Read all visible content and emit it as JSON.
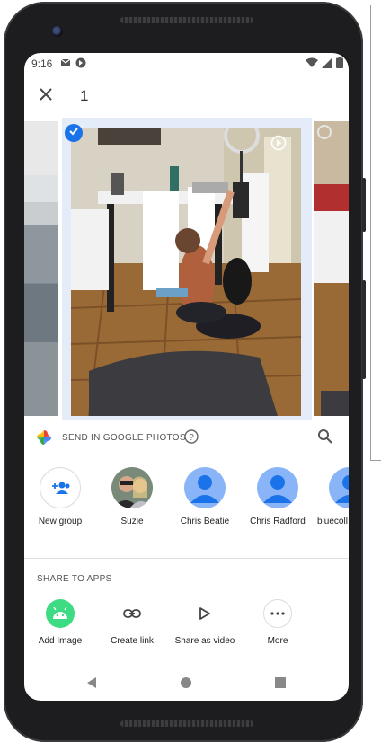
{
  "status_bar": {
    "time": "9:16",
    "left_icons": [
      "gmail-icon",
      "app-notification-icon"
    ],
    "right_icons": [
      "wifi-icon",
      "signal-icon",
      "battery-icon"
    ]
  },
  "top_bar": {
    "close_icon": "close-icon",
    "selected_count": "1"
  },
  "carousel": {
    "selected": true,
    "main_photo_is_video": true
  },
  "send_section": {
    "title": "SEND IN GOOGLE PHOTOS",
    "help_icon": "help-icon",
    "search_icon": "search-icon"
  },
  "contacts": [
    {
      "label": "New group",
      "icon": "add-group-icon"
    },
    {
      "label": "Suzie",
      "icon": "avatar-photo"
    },
    {
      "label": "Chris Beatie",
      "icon": "person-icon"
    },
    {
      "label": "Chris Radford",
      "icon": "person-icon"
    },
    {
      "label": "bluecoll",
      "icon": "person-icon"
    }
  ],
  "share_section": {
    "title": "SHARE TO APPS",
    "apps": [
      {
        "label": "Add Image",
        "icon": "android-icon"
      },
      {
        "label": "Create link",
        "icon": "link-icon"
      },
      {
        "label": "Share as video",
        "icon": "play-icon"
      },
      {
        "label": "More",
        "icon": "more-icon"
      }
    ]
  },
  "nav_bar": {
    "items": [
      "back-icon",
      "home-icon",
      "recents-icon"
    ]
  },
  "colors": {
    "accent": "#1a73e8",
    "avatar_bg": "#8ab4f8",
    "avatar_fg": "#1a73e8",
    "android_green": "#3ddc84",
    "phone_body": "#1d1d1f"
  }
}
